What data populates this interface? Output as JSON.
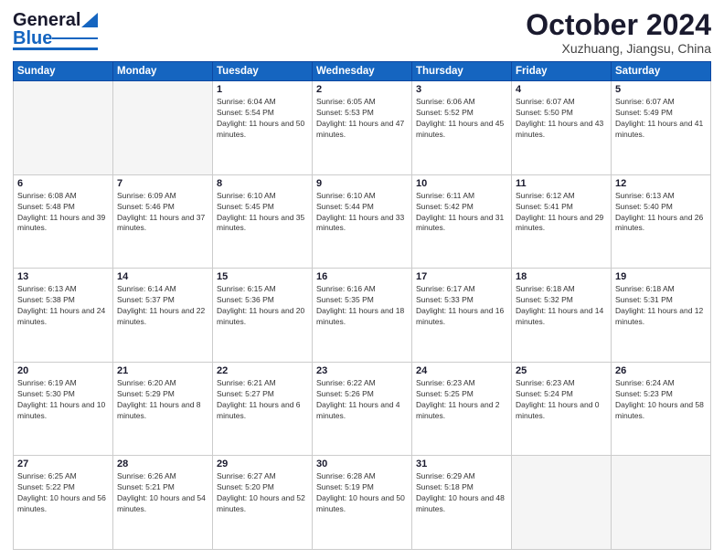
{
  "header": {
    "logo_general": "General",
    "logo_blue": "Blue",
    "month": "October 2024",
    "location": "Xuzhuang, Jiangsu, China"
  },
  "days_of_week": [
    "Sunday",
    "Monday",
    "Tuesday",
    "Wednesday",
    "Thursday",
    "Friday",
    "Saturday"
  ],
  "weeks": [
    [
      {
        "day": "",
        "info": ""
      },
      {
        "day": "",
        "info": ""
      },
      {
        "day": "1",
        "info": "Sunrise: 6:04 AM\nSunset: 5:54 PM\nDaylight: 11 hours and 50 minutes."
      },
      {
        "day": "2",
        "info": "Sunrise: 6:05 AM\nSunset: 5:53 PM\nDaylight: 11 hours and 47 minutes."
      },
      {
        "day": "3",
        "info": "Sunrise: 6:06 AM\nSunset: 5:52 PM\nDaylight: 11 hours and 45 minutes."
      },
      {
        "day": "4",
        "info": "Sunrise: 6:07 AM\nSunset: 5:50 PM\nDaylight: 11 hours and 43 minutes."
      },
      {
        "day": "5",
        "info": "Sunrise: 6:07 AM\nSunset: 5:49 PM\nDaylight: 11 hours and 41 minutes."
      }
    ],
    [
      {
        "day": "6",
        "info": "Sunrise: 6:08 AM\nSunset: 5:48 PM\nDaylight: 11 hours and 39 minutes."
      },
      {
        "day": "7",
        "info": "Sunrise: 6:09 AM\nSunset: 5:46 PM\nDaylight: 11 hours and 37 minutes."
      },
      {
        "day": "8",
        "info": "Sunrise: 6:10 AM\nSunset: 5:45 PM\nDaylight: 11 hours and 35 minutes."
      },
      {
        "day": "9",
        "info": "Sunrise: 6:10 AM\nSunset: 5:44 PM\nDaylight: 11 hours and 33 minutes."
      },
      {
        "day": "10",
        "info": "Sunrise: 6:11 AM\nSunset: 5:42 PM\nDaylight: 11 hours and 31 minutes."
      },
      {
        "day": "11",
        "info": "Sunrise: 6:12 AM\nSunset: 5:41 PM\nDaylight: 11 hours and 29 minutes."
      },
      {
        "day": "12",
        "info": "Sunrise: 6:13 AM\nSunset: 5:40 PM\nDaylight: 11 hours and 26 minutes."
      }
    ],
    [
      {
        "day": "13",
        "info": "Sunrise: 6:13 AM\nSunset: 5:38 PM\nDaylight: 11 hours and 24 minutes."
      },
      {
        "day": "14",
        "info": "Sunrise: 6:14 AM\nSunset: 5:37 PM\nDaylight: 11 hours and 22 minutes."
      },
      {
        "day": "15",
        "info": "Sunrise: 6:15 AM\nSunset: 5:36 PM\nDaylight: 11 hours and 20 minutes."
      },
      {
        "day": "16",
        "info": "Sunrise: 6:16 AM\nSunset: 5:35 PM\nDaylight: 11 hours and 18 minutes."
      },
      {
        "day": "17",
        "info": "Sunrise: 6:17 AM\nSunset: 5:33 PM\nDaylight: 11 hours and 16 minutes."
      },
      {
        "day": "18",
        "info": "Sunrise: 6:18 AM\nSunset: 5:32 PM\nDaylight: 11 hours and 14 minutes."
      },
      {
        "day": "19",
        "info": "Sunrise: 6:18 AM\nSunset: 5:31 PM\nDaylight: 11 hours and 12 minutes."
      }
    ],
    [
      {
        "day": "20",
        "info": "Sunrise: 6:19 AM\nSunset: 5:30 PM\nDaylight: 11 hours and 10 minutes."
      },
      {
        "day": "21",
        "info": "Sunrise: 6:20 AM\nSunset: 5:29 PM\nDaylight: 11 hours and 8 minutes."
      },
      {
        "day": "22",
        "info": "Sunrise: 6:21 AM\nSunset: 5:27 PM\nDaylight: 11 hours and 6 minutes."
      },
      {
        "day": "23",
        "info": "Sunrise: 6:22 AM\nSunset: 5:26 PM\nDaylight: 11 hours and 4 minutes."
      },
      {
        "day": "24",
        "info": "Sunrise: 6:23 AM\nSunset: 5:25 PM\nDaylight: 11 hours and 2 minutes."
      },
      {
        "day": "25",
        "info": "Sunrise: 6:23 AM\nSunset: 5:24 PM\nDaylight: 11 hours and 0 minutes."
      },
      {
        "day": "26",
        "info": "Sunrise: 6:24 AM\nSunset: 5:23 PM\nDaylight: 10 hours and 58 minutes."
      }
    ],
    [
      {
        "day": "27",
        "info": "Sunrise: 6:25 AM\nSunset: 5:22 PM\nDaylight: 10 hours and 56 minutes."
      },
      {
        "day": "28",
        "info": "Sunrise: 6:26 AM\nSunset: 5:21 PM\nDaylight: 10 hours and 54 minutes."
      },
      {
        "day": "29",
        "info": "Sunrise: 6:27 AM\nSunset: 5:20 PM\nDaylight: 10 hours and 52 minutes."
      },
      {
        "day": "30",
        "info": "Sunrise: 6:28 AM\nSunset: 5:19 PM\nDaylight: 10 hours and 50 minutes."
      },
      {
        "day": "31",
        "info": "Sunrise: 6:29 AM\nSunset: 5:18 PM\nDaylight: 10 hours and 48 minutes."
      },
      {
        "day": "",
        "info": ""
      },
      {
        "day": "",
        "info": ""
      }
    ]
  ]
}
